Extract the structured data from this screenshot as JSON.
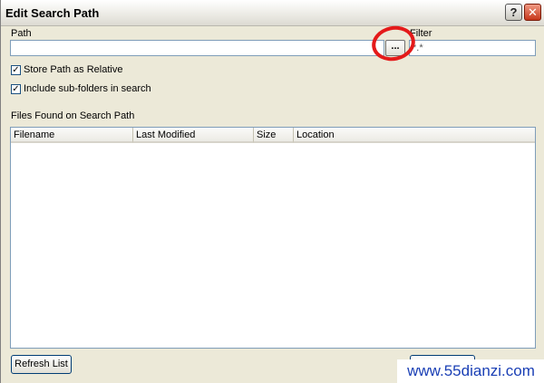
{
  "window": {
    "title": "Edit Search Path",
    "help_glyph": "?",
    "close_glyph": "✕"
  },
  "path": {
    "label": "Path",
    "value": "",
    "browse_label": "..."
  },
  "filter": {
    "label": "Filter",
    "value": "*.*"
  },
  "options": {
    "store_relative": {
      "label": "Store Path as Relative",
      "checked": true
    },
    "include_subfolders": {
      "label": "Include sub-folders in search",
      "checked": true
    }
  },
  "results": {
    "label": "Files Found on Search Path",
    "columns": [
      "Filename",
      "Last Modified",
      "Size",
      "Location"
    ]
  },
  "buttons": {
    "refresh": "Refresh List"
  },
  "watermark": "www.55dianzi.com",
  "colors": {
    "annotation_circle": "#e41a1a",
    "watermark_text": "#1a3fb5"
  }
}
